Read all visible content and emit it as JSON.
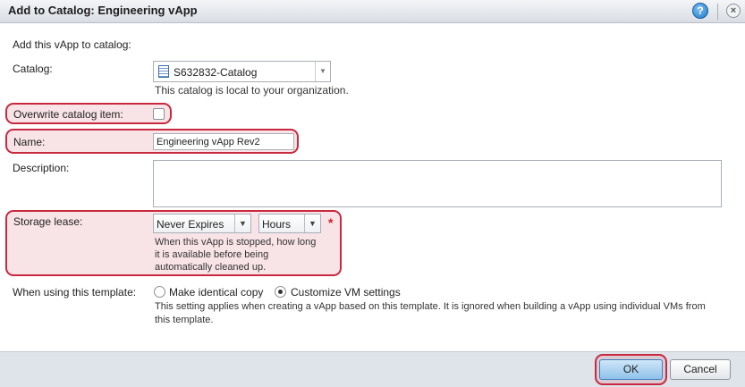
{
  "dialog": {
    "title": "Add to Catalog: Engineering vApp",
    "help_glyph": "?",
    "close_glyph": "×"
  },
  "form": {
    "intro": "Add this vApp to catalog:",
    "catalog": {
      "label": "Catalog:",
      "value": "S632832-Catalog",
      "hint": "This catalog is local to your organization."
    },
    "overwrite": {
      "label": "Overwrite catalog item:",
      "checked": false
    },
    "name": {
      "label": "Name:",
      "value": "Engineering vApp Rev2"
    },
    "description": {
      "label": "Description:",
      "value": ""
    },
    "storage_lease": {
      "label": "Storage lease:",
      "duration": "Never Expires",
      "unit": "Hours",
      "required_marker": "*",
      "hint_line1": "When this vApp is stopped, how long",
      "hint_line2": "it is available before being",
      "hint_line3": "automatically cleaned up."
    },
    "template": {
      "label": "When using this template:",
      "option_identical": "Make identical copy",
      "option_customize": "Customize VM settings",
      "selected": "Customize VM settings",
      "hint_line1": "This setting applies when creating a vApp based on this template. It is ignored when building a vApp using individual VMs from",
      "hint_line2": "this template."
    }
  },
  "footer": {
    "ok_label": "OK",
    "cancel_label": "Cancel"
  },
  "colors": {
    "highlight": "#c8293f",
    "title_bar": "#e6e9ed",
    "footer": "#dfe3ea",
    "primary_button": "#8fc2ea"
  }
}
